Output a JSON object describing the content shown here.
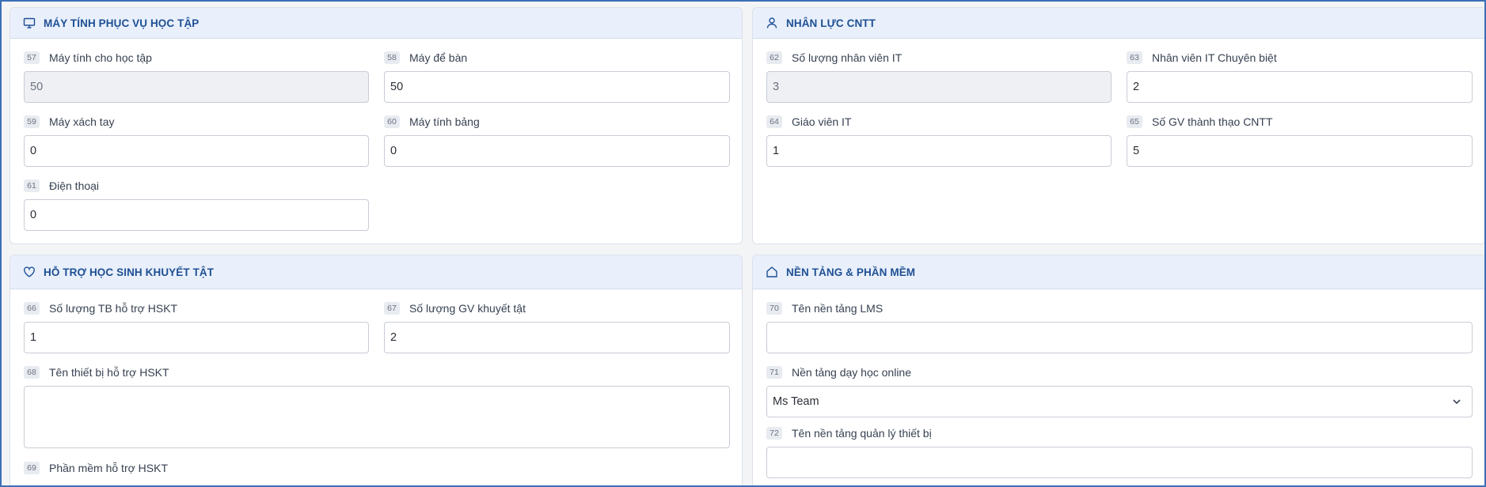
{
  "sections": {
    "computers": {
      "title": "MÁY TÍNH PHỤC VỤ HỌC TẬP",
      "icon": "monitor-icon",
      "fields": [
        {
          "num": "57",
          "label": "Máy tính cho học tập",
          "value": "50",
          "readonly": true
        },
        {
          "num": "58",
          "label": "Máy để bàn",
          "value": "50"
        },
        {
          "num": "59",
          "label": "Máy xách tay",
          "value": "0"
        },
        {
          "num": "60",
          "label": "Máy tính bảng",
          "value": "0"
        },
        {
          "num": "61",
          "label": "Điện thoại",
          "value": "0"
        }
      ]
    },
    "it_staff": {
      "title": "NHÂN LỰC CNTT",
      "icon": "user-icon",
      "fields": [
        {
          "num": "62",
          "label": "Số lượng nhân viên IT",
          "value": "3",
          "readonly": true
        },
        {
          "num": "63",
          "label": "Nhân viên IT Chuyên biệt",
          "value": "2"
        },
        {
          "num": "64",
          "label": "Giáo viên IT",
          "value": "1"
        },
        {
          "num": "65",
          "label": "Số GV thành thạo CNTT",
          "value": "5"
        }
      ]
    },
    "disability": {
      "title": "HỖ TRỢ HỌC SINH KHUYẾT TẬT",
      "icon": "heart-icon",
      "fields": [
        {
          "num": "66",
          "label": "Số lượng TB hỗ trợ HSKT",
          "value": "1"
        },
        {
          "num": "67",
          "label": "Số lượng GV khuyết tật",
          "value": "2"
        },
        {
          "num": "68",
          "label": "Tên thiết bị hỗ trợ HSKT",
          "value": ""
        },
        {
          "num": "69",
          "label": "Phần mềm hỗ trợ HSKT",
          "value": ""
        }
      ]
    },
    "platforms": {
      "title": "NỀN TẢNG & PHẦN MỀM",
      "icon": "home-icon",
      "fields": [
        {
          "num": "70",
          "label": "Tên nền tảng LMS",
          "value": ""
        },
        {
          "num": "71",
          "label": "Nền tảng dạy học online",
          "value": "Ms Team"
        },
        {
          "num": "72",
          "label": "Tên nền tảng quản lý thiết bị",
          "value": ""
        }
      ]
    }
  },
  "colors": {
    "header_bg": "#e9f0fb",
    "header_text": "#1e4f94",
    "frame_border": "#3b6fb6",
    "readonly_bg": "#eef0f3"
  }
}
